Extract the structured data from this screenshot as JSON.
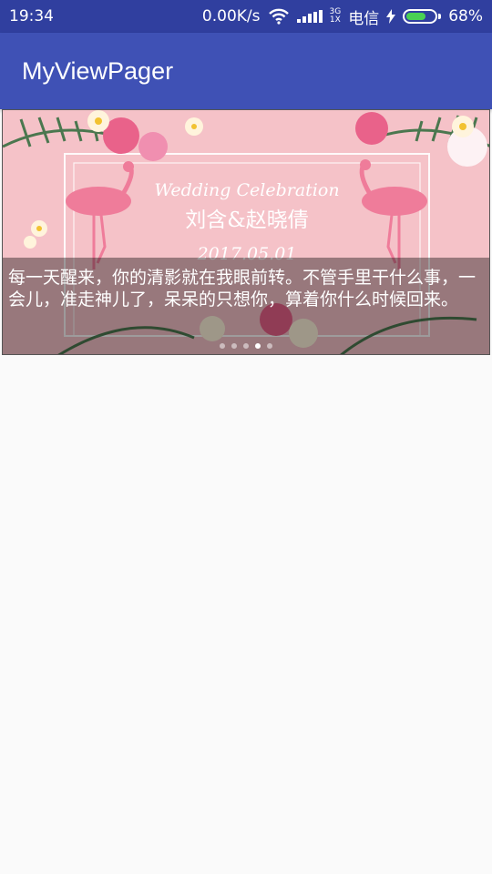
{
  "status_bar": {
    "time": "19:34",
    "network_speed": "0.00K/s",
    "net_type_top": "3G",
    "net_type_bottom": "1X",
    "carrier": "电信",
    "battery": "68%",
    "battery_level": 0.68,
    "icons": [
      "wifi-icon",
      "signal-icon",
      "charging-icon",
      "battery-icon"
    ]
  },
  "app_bar": {
    "title": "MyViewPager"
  },
  "pager": {
    "slide_text_line1": "Wedding Celebration",
    "slide_text_line2": "刘含&赵晓倩",
    "slide_text_line3": "2017.05.01",
    "caption": "每一天醒来，你的清影就在我眼前转。不管手里干什么事，一会儿，准走神儿了，呆呆的只想你，算着你什么时候回来。",
    "page_count": 5,
    "active_page": 4
  },
  "colors": {
    "status_bar": "#303f9f",
    "app_bar": "#3f51b5",
    "slide_background": "#f5c2c8",
    "background": "#fafafa"
  }
}
